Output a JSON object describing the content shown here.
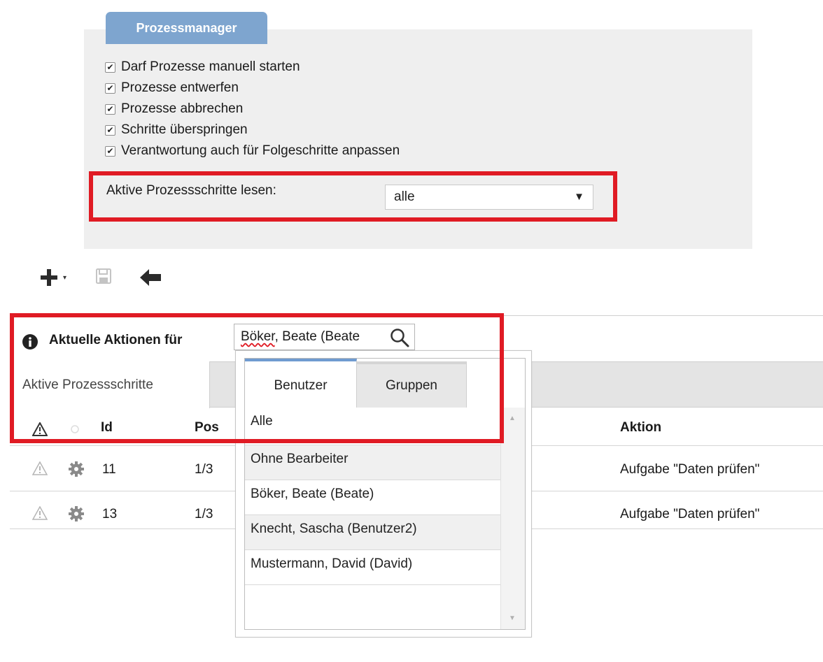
{
  "panel": {
    "tab_title": "Prozessmanager",
    "checkboxes": [
      {
        "label": "Darf Prozesse manuell starten",
        "checked": true
      },
      {
        "label": "Prozesse entwerfen",
        "checked": true
      },
      {
        "label": "Prozesse abbrechen",
        "checked": true
      },
      {
        "label": "Schritte überspringen",
        "checked": true
      },
      {
        "label": "Verantwortung auch für Folgeschritte anpassen",
        "checked": true
      }
    ],
    "active_steps_label": "Aktive Prozessschritte lesen:",
    "active_steps_value": "alle"
  },
  "toolbar": {
    "icons": [
      "plus-icon",
      "save-icon",
      "back-arrow-icon"
    ]
  },
  "actions": {
    "label": "Aktuelle Aktionen für",
    "user_value_prefix": "Böker",
    "user_value_rest": ", Beate (Beate"
  },
  "tabs": {
    "active_label": "Aktive Prozessschritte"
  },
  "table": {
    "headers": {
      "id": "Id",
      "pos": "Pos",
      "action": "Aktion"
    },
    "rows": [
      {
        "id": "11",
        "pos": "1/3",
        "action": "Aufgabe \"Daten prüfen\""
      },
      {
        "id": "13",
        "pos": "1/3",
        "action": "Aufgabe \"Daten prüfen\""
      }
    ]
  },
  "dropdown": {
    "tabs": {
      "users": "Benutzer",
      "groups": "Gruppen"
    },
    "items": [
      "Alle",
      "Ohne Bearbeiter",
      "Böker, Beate (Beate)",
      "Knecht, Sascha (Benutzer2)",
      "Mustermann, David (David)"
    ]
  },
  "colors": {
    "accent": "#7ea5cf",
    "highlight_box": "#e01b24",
    "panel_bg": "#efefef"
  }
}
